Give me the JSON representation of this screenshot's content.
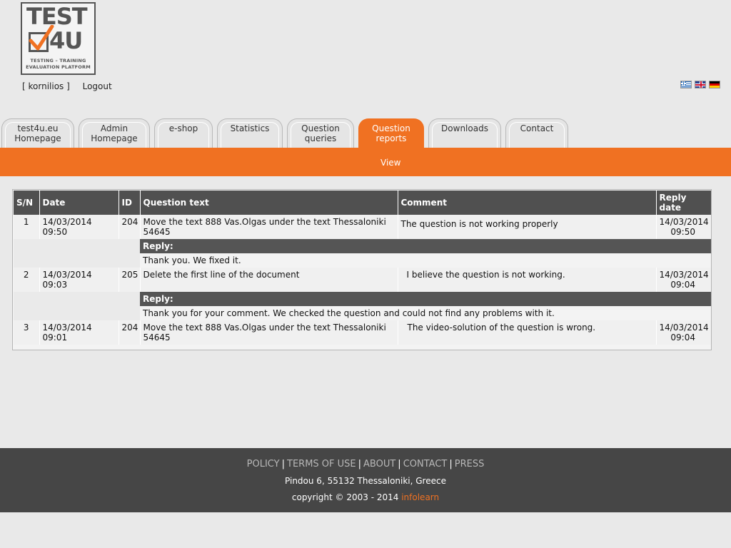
{
  "logo": {
    "word_top": "TEST",
    "word_bottom": "4U",
    "tagline_1": "TESTING – TRAINING",
    "tagline_2": "EVALUATION PLATFORM",
    "accent_color": "#f07122"
  },
  "user": {
    "username": "[ kornilios ]",
    "logout": "Logout"
  },
  "languages": [
    {
      "code": "el",
      "icon": "greek-flag-icon"
    },
    {
      "code": "en",
      "icon": "uk-flag-icon"
    },
    {
      "code": "de",
      "icon": "german-flag-icon"
    }
  ],
  "tabs": [
    {
      "line1": "test4u.eu",
      "line2": "Homepage",
      "active": false
    },
    {
      "line1": "Admin",
      "line2": "Homepage",
      "active": false
    },
    {
      "line1": "e-shop",
      "line2": "",
      "active": false
    },
    {
      "line1": "Statistics",
      "line2": "",
      "active": false
    },
    {
      "line1": "Question",
      "line2": "queries",
      "active": false
    },
    {
      "line1": "Question",
      "line2": "reports",
      "active": true
    },
    {
      "line1": "Downloads",
      "line2": "",
      "active": false
    },
    {
      "line1": "Contact",
      "line2": "",
      "active": false
    }
  ],
  "subnav": {
    "view": "View"
  },
  "table": {
    "headers": {
      "sn": "S/N",
      "date": "Date",
      "id": "ID",
      "question": "Question text",
      "comment": "Comment",
      "reply_date": "Reply date"
    },
    "reply_label": "Reply:",
    "rows": [
      {
        "sn": "1",
        "date": "14/03/2014 09:50",
        "id": "204",
        "question": "Move the text 888 Vas.Olgas under the text Thessaloniki 54645",
        "comment": "The question is not working properly",
        "reply_date_1": "14/03/2014",
        "reply_date_2": "09:50",
        "reply": "Thank you. We fixed it."
      },
      {
        "sn": "2",
        "date": "14/03/2014 09:03",
        "id": "205",
        "question": "Delete the first line of the document",
        "comment": "I believe the question is not working.",
        "reply_date_1": "14/03/2014",
        "reply_date_2": "09:04",
        "reply": "Thank you for your comment. We checked the question and could not find any problems with it."
      },
      {
        "sn": "3",
        "date": "14/03/2014 09:01",
        "id": "204",
        "question": "Move the text 888 Vas.Olgas under the text Thessaloniki 54645",
        "comment": "The video-solution of the question is wrong.",
        "reply_date_1": "14/03/2014",
        "reply_date_2": "09:04"
      }
    ]
  },
  "footer": {
    "links": [
      "POLICY",
      "TERMS OF USE",
      "ABOUT",
      "CONTACT",
      "PRESS"
    ],
    "address": "Pindou 6, 55132 Thessaloniki, Greece",
    "copyright": "copyright © 2003 - 2014 ",
    "brand": "infolearn"
  },
  "colors": {
    "accent": "#f07122",
    "header_dark": "#505050",
    "footer_bg": "#464646",
    "page_bg": "#e9e9e9"
  }
}
